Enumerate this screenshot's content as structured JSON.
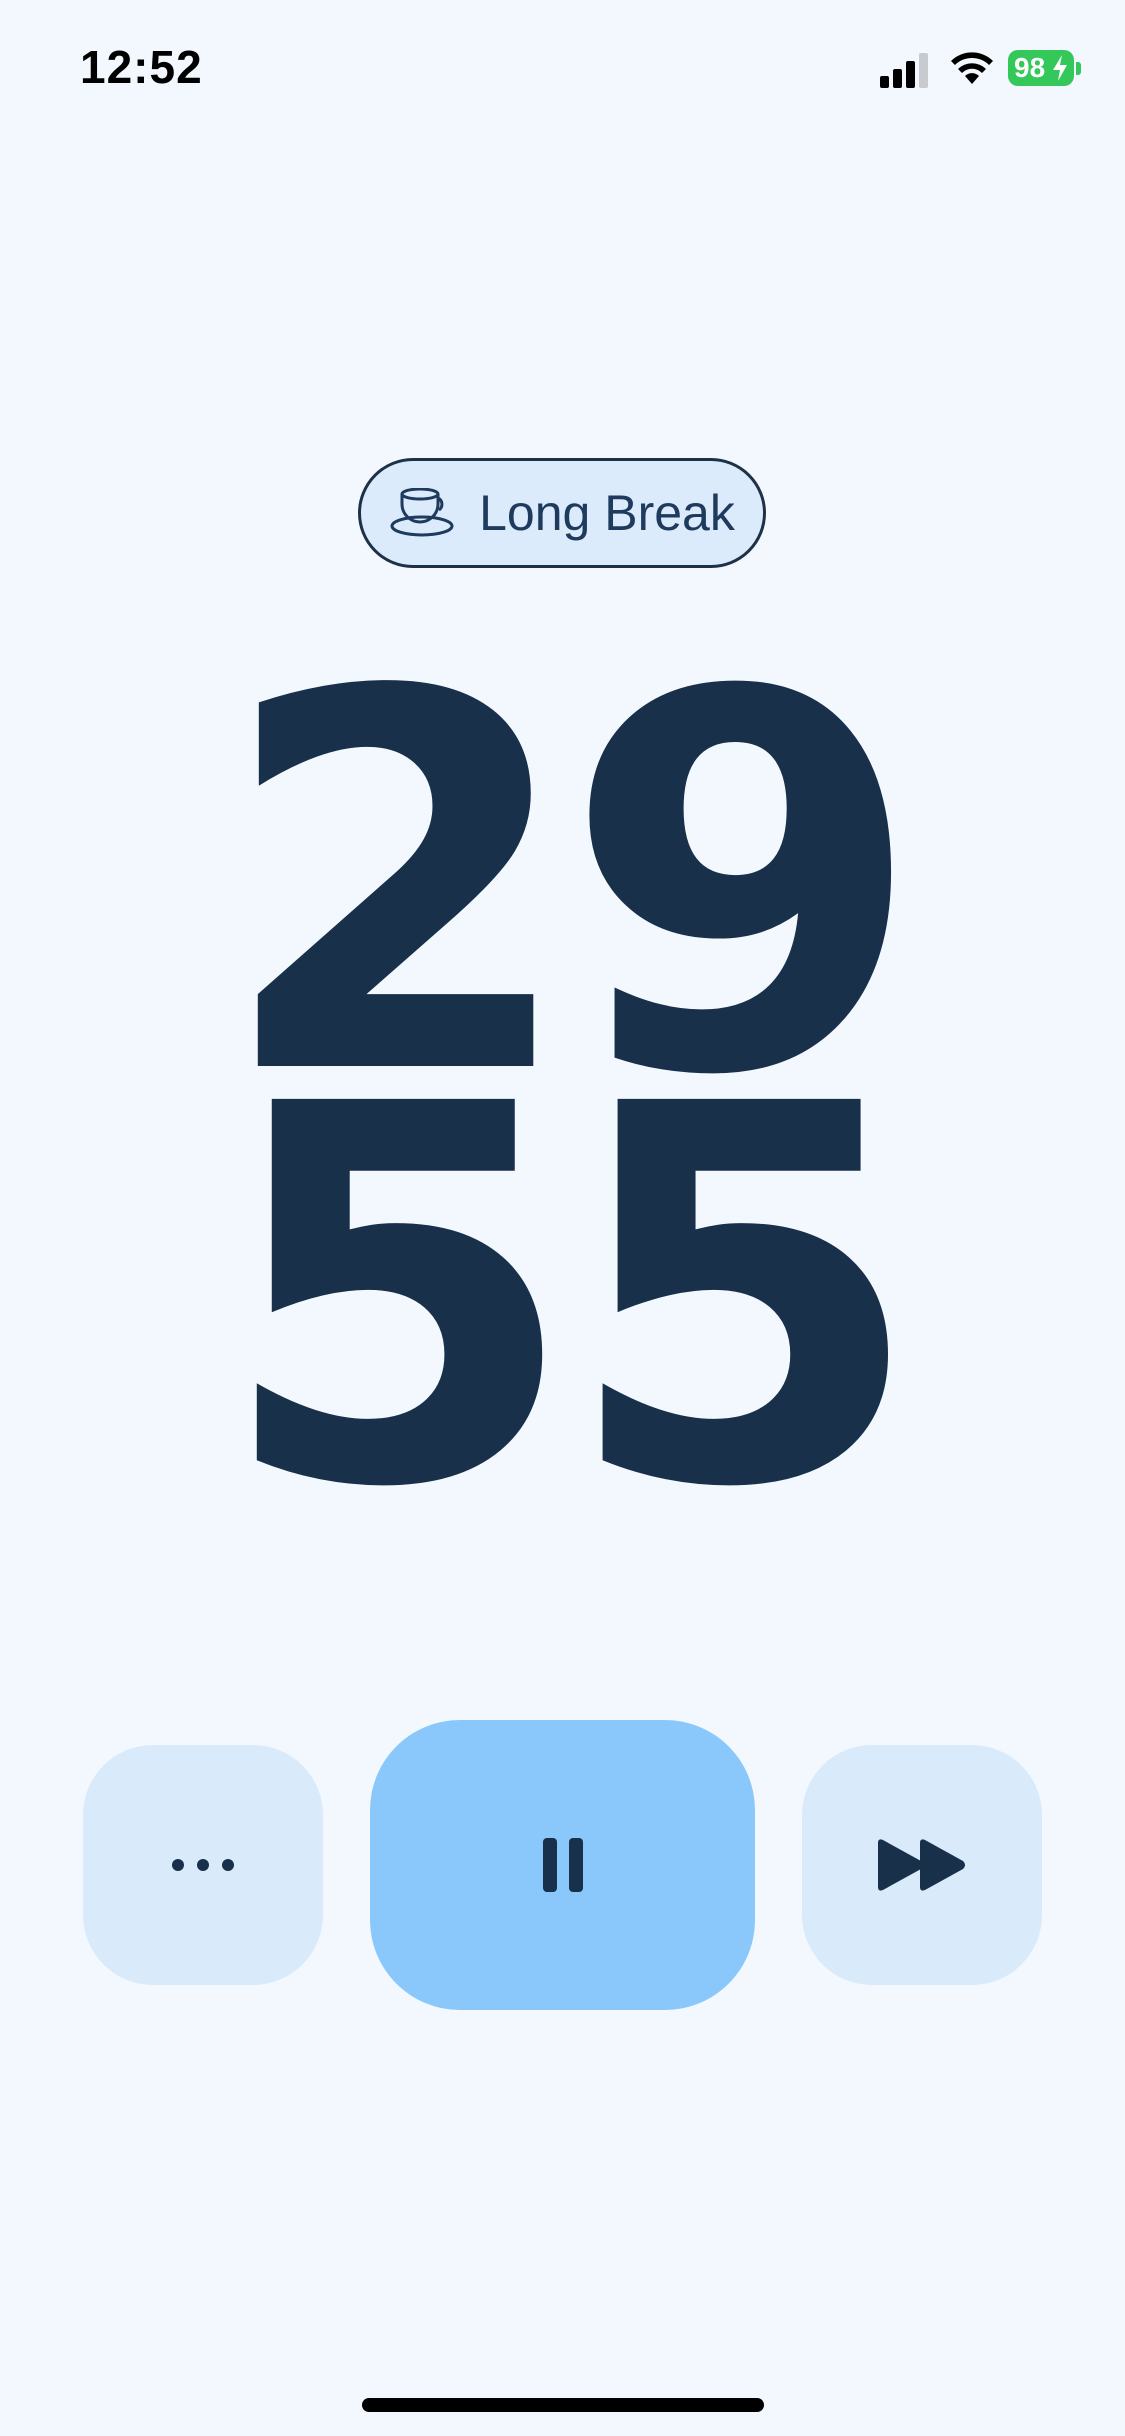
{
  "status_bar": {
    "time": "12:52",
    "battery_level": "98",
    "icons": [
      "signal-icon",
      "wifi-icon",
      "battery-charging-icon"
    ]
  },
  "mode": {
    "label": "Long Break",
    "icon": "coffee-cup-icon"
  },
  "timer": {
    "minutes": "29",
    "seconds": "55"
  },
  "controls": {
    "more_icon": "more-dots-icon",
    "pause_icon": "pause-icon",
    "skip_icon": "skip-forward-icon"
  },
  "colors": {
    "background": "#f2f8fd",
    "text": "#18304a",
    "primary_button": "#8ac8fc",
    "secondary_button": "#d9eafb",
    "pill_background": "#dbebfb",
    "battery": "#34c759"
  }
}
